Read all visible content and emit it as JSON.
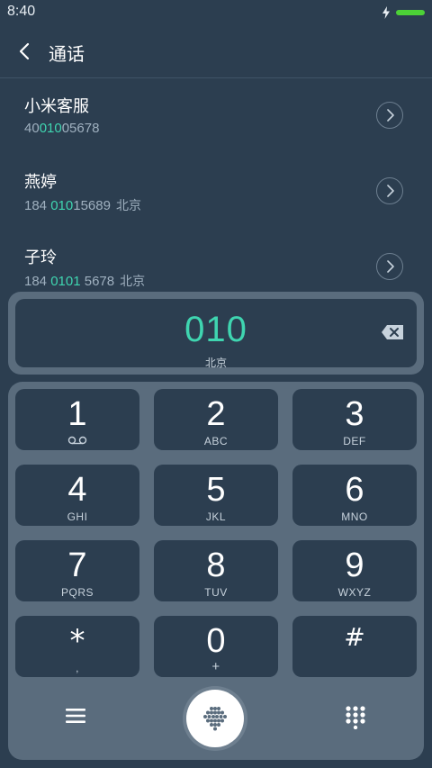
{
  "status": {
    "time": "8:40",
    "battery_color": "#4cd137"
  },
  "header": {
    "title": "通话",
    "back_icon": "chevron-left-icon"
  },
  "contacts": [
    {
      "name": "小米客服",
      "number_prefix": "40",
      "number_match": "010",
      "number_suffix": "05678",
      "location": ""
    },
    {
      "name": "燕婷",
      "number_prefix": "184 ",
      "number_match": "010",
      "number_suffix": "15689",
      "location": "北京"
    },
    {
      "name": "子玲",
      "number_prefix": "184 ",
      "number_match": "0101",
      "number_suffix": " 5678",
      "location": "北京"
    }
  ],
  "dialer": {
    "number": "010",
    "location": "北京",
    "accent_color": "#3fd5b0"
  },
  "keys": [
    {
      "digit": "1",
      "letters": ""
    },
    {
      "digit": "2",
      "letters": "ABC"
    },
    {
      "digit": "3",
      "letters": "DEF"
    },
    {
      "digit": "4",
      "letters": "GHI"
    },
    {
      "digit": "5",
      "letters": "JKL"
    },
    {
      "digit": "6",
      "letters": "MNO"
    },
    {
      "digit": "7",
      "letters": "PQRS"
    },
    {
      "digit": "8",
      "letters": "TUV"
    },
    {
      "digit": "9",
      "letters": "WXYZ"
    },
    {
      "digit": "*",
      "letters": ","
    },
    {
      "digit": "0",
      "letters": "+"
    },
    {
      "digit": "#",
      "letters": ""
    }
  ],
  "bottom": {
    "menu_icon": "menu-icon",
    "call_icon": "dialpad-dots-icon",
    "toggle_icon": "keypad-toggle-icon"
  }
}
